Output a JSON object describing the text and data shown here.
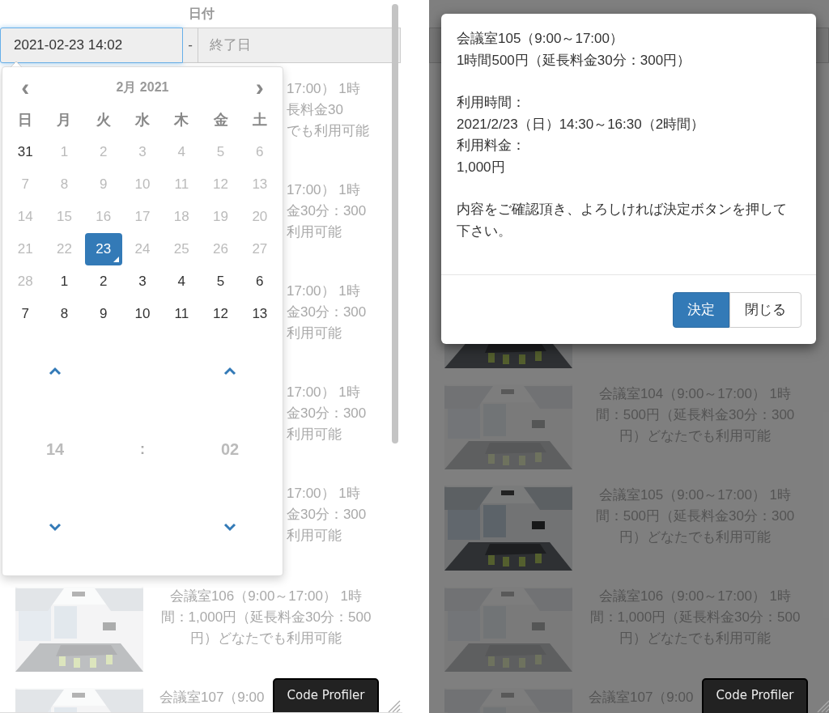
{
  "left_screen": {
    "header": "日付",
    "date_range": {
      "start": {
        "value": "2021-02-23 14:02",
        "focused": true
      },
      "separator": "-",
      "end": {
        "placeholder": "終了日"
      }
    },
    "rows": [
      {
        "kind": "fragment",
        "lines": [
          "17:00） 1時",
          "長料金30",
          "でも利用可能"
        ]
      },
      {
        "kind": "fragment",
        "lines": [
          "17:00） 1時",
          "金30分：300",
          "利用可能"
        ]
      },
      {
        "kind": "fragment",
        "lines": [
          "17:00） 1時",
          "金30分：300",
          "利用可能"
        ]
      },
      {
        "kind": "fragment",
        "lines": [
          "17:00） 1時",
          "金30分：300",
          "利用可能"
        ]
      },
      {
        "kind": "fragment",
        "lines": [
          "17:00） 1時",
          "金30分：300",
          "利用可能"
        ]
      },
      {
        "kind": "full",
        "faded": true,
        "lines": [
          "会議室106（9:00～17:00） 1時",
          "間：1,000円（延長料金30分：500",
          "円）どなたでも利用可能"
        ]
      },
      {
        "kind": "cut",
        "faded": true,
        "lines": [
          "会議室107（9:00"
        ]
      }
    ],
    "calendar": {
      "prev": "‹",
      "title": "2月 2021",
      "next": "›",
      "weekdays": [
        "日",
        "月",
        "火",
        "水",
        "木",
        "金",
        "土"
      ],
      "weeks": [
        [
          {
            "d": "31",
            "disabled": false,
            "selected": false,
            "today": false
          },
          {
            "d": "1",
            "disabled": true,
            "selected": false,
            "today": false
          },
          {
            "d": "2",
            "disabled": true,
            "selected": false,
            "today": false
          },
          {
            "d": "3",
            "disabled": true,
            "selected": false,
            "today": false
          },
          {
            "d": "4",
            "disabled": true,
            "selected": false,
            "today": false
          },
          {
            "d": "5",
            "disabled": true,
            "selected": false,
            "today": false
          },
          {
            "d": "6",
            "disabled": true,
            "selected": false,
            "today": false
          }
        ],
        [
          {
            "d": "7",
            "disabled": true,
            "selected": false,
            "today": false
          },
          {
            "d": "8",
            "disabled": true,
            "selected": false,
            "today": false
          },
          {
            "d": "9",
            "disabled": true,
            "selected": false,
            "today": false
          },
          {
            "d": "10",
            "disabled": true,
            "selected": false,
            "today": false
          },
          {
            "d": "11",
            "disabled": true,
            "selected": false,
            "today": false
          },
          {
            "d": "12",
            "disabled": true,
            "selected": false,
            "today": false
          },
          {
            "d": "13",
            "disabled": true,
            "selected": false,
            "today": false
          }
        ],
        [
          {
            "d": "14",
            "disabled": true,
            "selected": false,
            "today": false
          },
          {
            "d": "15",
            "disabled": true,
            "selected": false,
            "today": false
          },
          {
            "d": "16",
            "disabled": true,
            "selected": false,
            "today": false
          },
          {
            "d": "17",
            "disabled": true,
            "selected": false,
            "today": false
          },
          {
            "d": "18",
            "disabled": true,
            "selected": false,
            "today": false
          },
          {
            "d": "19",
            "disabled": true,
            "selected": false,
            "today": false
          },
          {
            "d": "20",
            "disabled": true,
            "selected": false,
            "today": false
          }
        ],
        [
          {
            "d": "21",
            "disabled": true,
            "selected": false,
            "today": false
          },
          {
            "d": "22",
            "disabled": true,
            "selected": false,
            "today": false
          },
          {
            "d": "23",
            "disabled": false,
            "selected": true,
            "today": true
          },
          {
            "d": "24",
            "disabled": true,
            "selected": false,
            "today": false
          },
          {
            "d": "25",
            "disabled": true,
            "selected": false,
            "today": false
          },
          {
            "d": "26",
            "disabled": true,
            "selected": false,
            "today": false
          },
          {
            "d": "27",
            "disabled": true,
            "selected": false,
            "today": false
          }
        ],
        [
          {
            "d": "28",
            "disabled": true,
            "selected": false,
            "today": false
          },
          {
            "d": "1",
            "disabled": false,
            "selected": false,
            "today": false
          },
          {
            "d": "2",
            "disabled": false,
            "selected": false,
            "today": false
          },
          {
            "d": "3",
            "disabled": false,
            "selected": false,
            "today": false
          },
          {
            "d": "4",
            "disabled": false,
            "selected": false,
            "today": false
          },
          {
            "d": "5",
            "disabled": false,
            "selected": false,
            "today": false
          },
          {
            "d": "6",
            "disabled": false,
            "selected": false,
            "today": false
          }
        ],
        [
          {
            "d": "7",
            "disabled": false,
            "selected": false,
            "today": false
          },
          {
            "d": "8",
            "disabled": false,
            "selected": false,
            "today": false
          },
          {
            "d": "9",
            "disabled": false,
            "selected": false,
            "today": false
          },
          {
            "d": "10",
            "disabled": false,
            "selected": false,
            "today": false
          },
          {
            "d": "11",
            "disabled": false,
            "selected": false,
            "today": false
          },
          {
            "d": "12",
            "disabled": false,
            "selected": false,
            "today": false
          },
          {
            "d": "13",
            "disabled": false,
            "selected": false,
            "today": false
          }
        ]
      ],
      "time": {
        "hour": "14",
        "colon": ":",
        "minute": "02"
      }
    },
    "profiler_button": "Code Profiler"
  },
  "right_screen": {
    "rows": [
      {
        "kind": "image_only",
        "faded": false
      },
      {
        "kind": "full",
        "faded": true,
        "lines": [
          "会議室104（9:00～17:00） 1時",
          "間：500円（延長料金30分：300",
          "円）どなたでも利用可能"
        ]
      },
      {
        "kind": "full",
        "faded": false,
        "lines": [
          "会議室105（9:00～17:00） 1時",
          "間：500円（延長料金30分：300",
          "円）どなたでも利用可能"
        ]
      },
      {
        "kind": "full",
        "faded": true,
        "lines": [
          "会議室106（9:00～17:00） 1時",
          "間：1,000円（延長料金30分：500",
          "円）どなたでも利用可能"
        ]
      },
      {
        "kind": "cut",
        "faded": true,
        "lines": [
          "会議室107（9:00"
        ]
      }
    ],
    "dialog": {
      "paragraphs": [
        [
          "会議室105（9:00～17:00）",
          "1時間500円（延長料金30分：300円）"
        ],
        [
          "利用時間：",
          "2021/2/23（日）14:30～16:30（2時間）",
          "利用料金：",
          "1,000円"
        ],
        [
          "内容をご確認頂き、よろしければ決定ボタンを押して下さい。"
        ]
      ],
      "buttons": [
        {
          "label": "決定",
          "kind": "primary"
        },
        {
          "label": "閉じる",
          "kind": "default"
        }
      ]
    },
    "profiler_button": "Code Profiler"
  }
}
